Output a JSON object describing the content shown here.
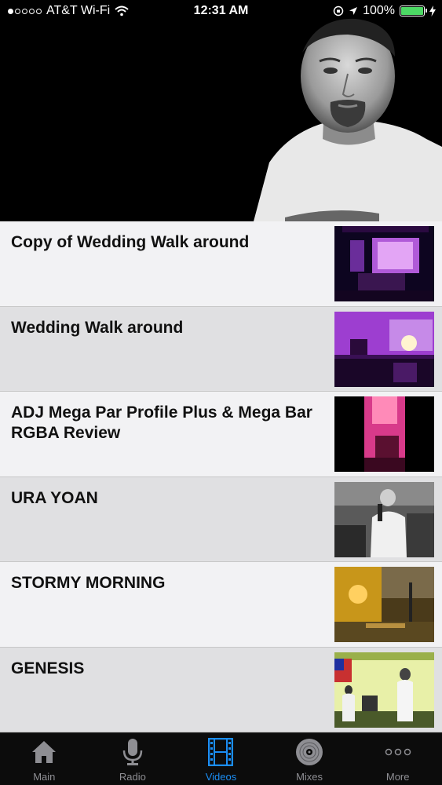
{
  "status_bar": {
    "carrier": "AT&T Wi-Fi",
    "time": "12:31 AM",
    "battery_percent": "100%",
    "battery_level": 1.0,
    "signal_bars": 1,
    "battery_color": "#4cd964"
  },
  "videos": [
    {
      "title": "Copy of Wedding Walk around",
      "thumb": "purple-stage"
    },
    {
      "title": "Wedding Walk around",
      "thumb": "purple-room"
    },
    {
      "title": "ADJ Mega Par Profile Plus  & Mega Bar RGBA Review",
      "thumb": "pink-light"
    },
    {
      "title": "URA YOAN",
      "thumb": "singer-garage"
    },
    {
      "title": "STORMY MORNING",
      "thumb": "storm-street"
    },
    {
      "title": "GENESIS",
      "thumb": "stage-flag"
    }
  ],
  "tab_bar": {
    "tabs": [
      {
        "label": "Main",
        "icon": "home-icon",
        "active": false
      },
      {
        "label": "Radio",
        "icon": "microphone-icon",
        "active": false
      },
      {
        "label": "Videos",
        "icon": "film-icon",
        "active": true
      },
      {
        "label": "Mixes",
        "icon": "vinyl-icon",
        "active": false
      },
      {
        "label": "More",
        "icon": "more-icon",
        "active": false
      }
    ],
    "active_color": "#1b8ef5",
    "inactive_color": "#8e8e93"
  }
}
